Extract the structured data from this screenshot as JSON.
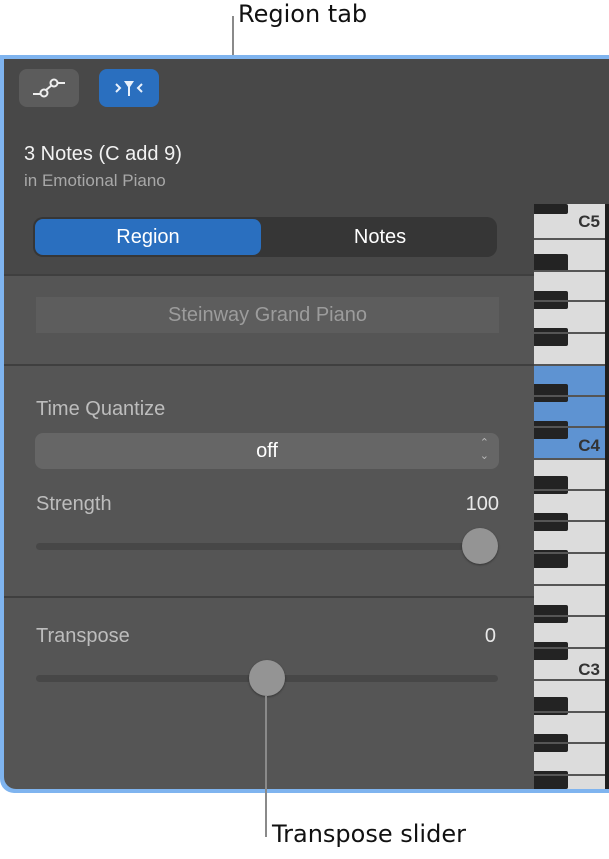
{
  "callouts": {
    "region_tab": "Region tab",
    "transpose_slider": "Transpose slider"
  },
  "toolbar": {
    "buttons": [
      {
        "icon": "automation-icon",
        "state": "inactive"
      },
      {
        "icon": "smart-controls-filter-icon",
        "state": "active"
      }
    ]
  },
  "header": {
    "title": "3 Notes (C add 9)",
    "subtitle": "in Emotional Piano"
  },
  "tabs": [
    {
      "label": "Region",
      "active": true
    },
    {
      "label": "Notes",
      "active": false
    }
  ],
  "instrument": {
    "name": "Steinway Grand Piano"
  },
  "time_quantize": {
    "label": "Time Quantize",
    "selected": "off"
  },
  "strength": {
    "label": "Strength",
    "value": "100",
    "fraction": 1.0
  },
  "transpose": {
    "label": "Transpose",
    "value": "0",
    "fraction": 0.5
  },
  "keyboard": {
    "octave_labels": [
      "C5",
      "C4",
      "C3"
    ],
    "highlighted_range": "C4 octave lower keys",
    "highlight_color": "#5e93d2"
  },
  "colors": {
    "accent": "#2a6fbf",
    "panel_bg": "#555555",
    "header_bg": "#484848",
    "frame_border": "#7fb4ef"
  }
}
